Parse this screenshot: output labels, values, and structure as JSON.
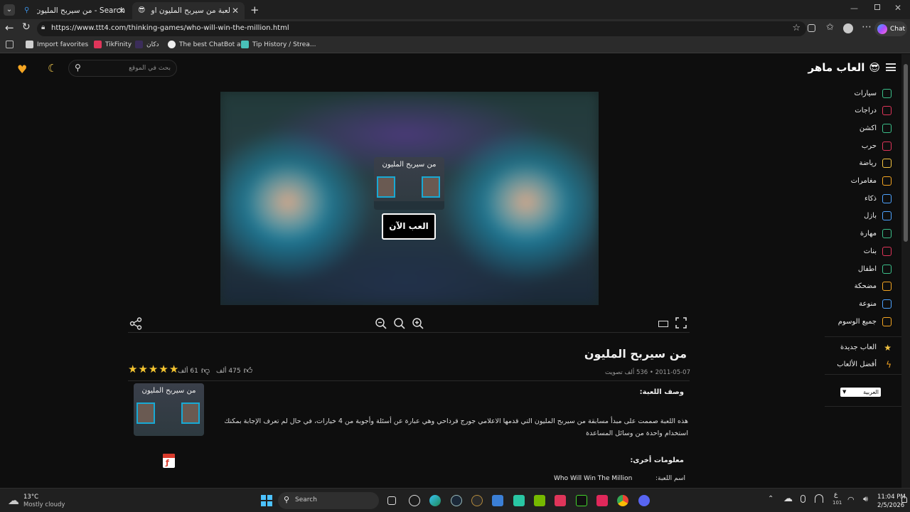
{
  "browser": {
    "tabs": [
      {
        "label": "Search - من سيربح المليون",
        "active": false
      },
      {
        "label": "لعبة من سيربح المليون اون لاين - ال",
        "active": true
      }
    ],
    "url": "https://www.ttt4.com/thinking-games/who-will-win-the-million.html",
    "chat_label": "Chat",
    "bookmarks": [
      "Import favorites",
      "TikFinity",
      "دكان",
      "The best ChatBot a...",
      "Tip History / Strea..."
    ]
  },
  "site": {
    "logo_text": "العاب ماهر",
    "search_placeholder": "بحث في الموقع",
    "categories": [
      "سيارات",
      "دراجات",
      "اكشن",
      "حرب",
      "رياضة",
      "مغامرات",
      "ذكاء",
      "بازل",
      "مهارة",
      "بنات",
      "اطفال",
      "مضحكة",
      "منوعة",
      "جميع الوسوم"
    ],
    "extra_links": [
      "العاب جديدة",
      "أفضل الألعاب"
    ],
    "language": "العربية"
  },
  "game": {
    "thumb_title": "من سيربح المليون",
    "play_label": "العب الآن",
    "title": "من سيربح المليون",
    "meta": "2011-05-07 • 536 ألف تصويت",
    "likes": "475 ألف",
    "dislikes": "61 ألف",
    "rating": 5,
    "desc_heading": "وصف اللعبة:",
    "description": "هذه اللعبة صممت على مبدأ مسابقة من سيربح المليون التي قدمها الاعلامي جورج قرداحي وهي عبارة عن أسئلة وأجوبة من 4 خيارات، في حال لم تعرف الإجابة بمكنك استخدام واحدة من وسائل المساعدة",
    "info_heading": "معلومات أخرى:",
    "name_label": "اسم اللعبة:",
    "name_value": "Who Will Win The Million"
  },
  "taskbar": {
    "temperature": "13°C",
    "weather": "Mostly cloudy",
    "search_label": "Search",
    "time": "11:04 PM",
    "date": "2/5/2026",
    "keyboard": "ع",
    "keyboard_sub": "101"
  }
}
